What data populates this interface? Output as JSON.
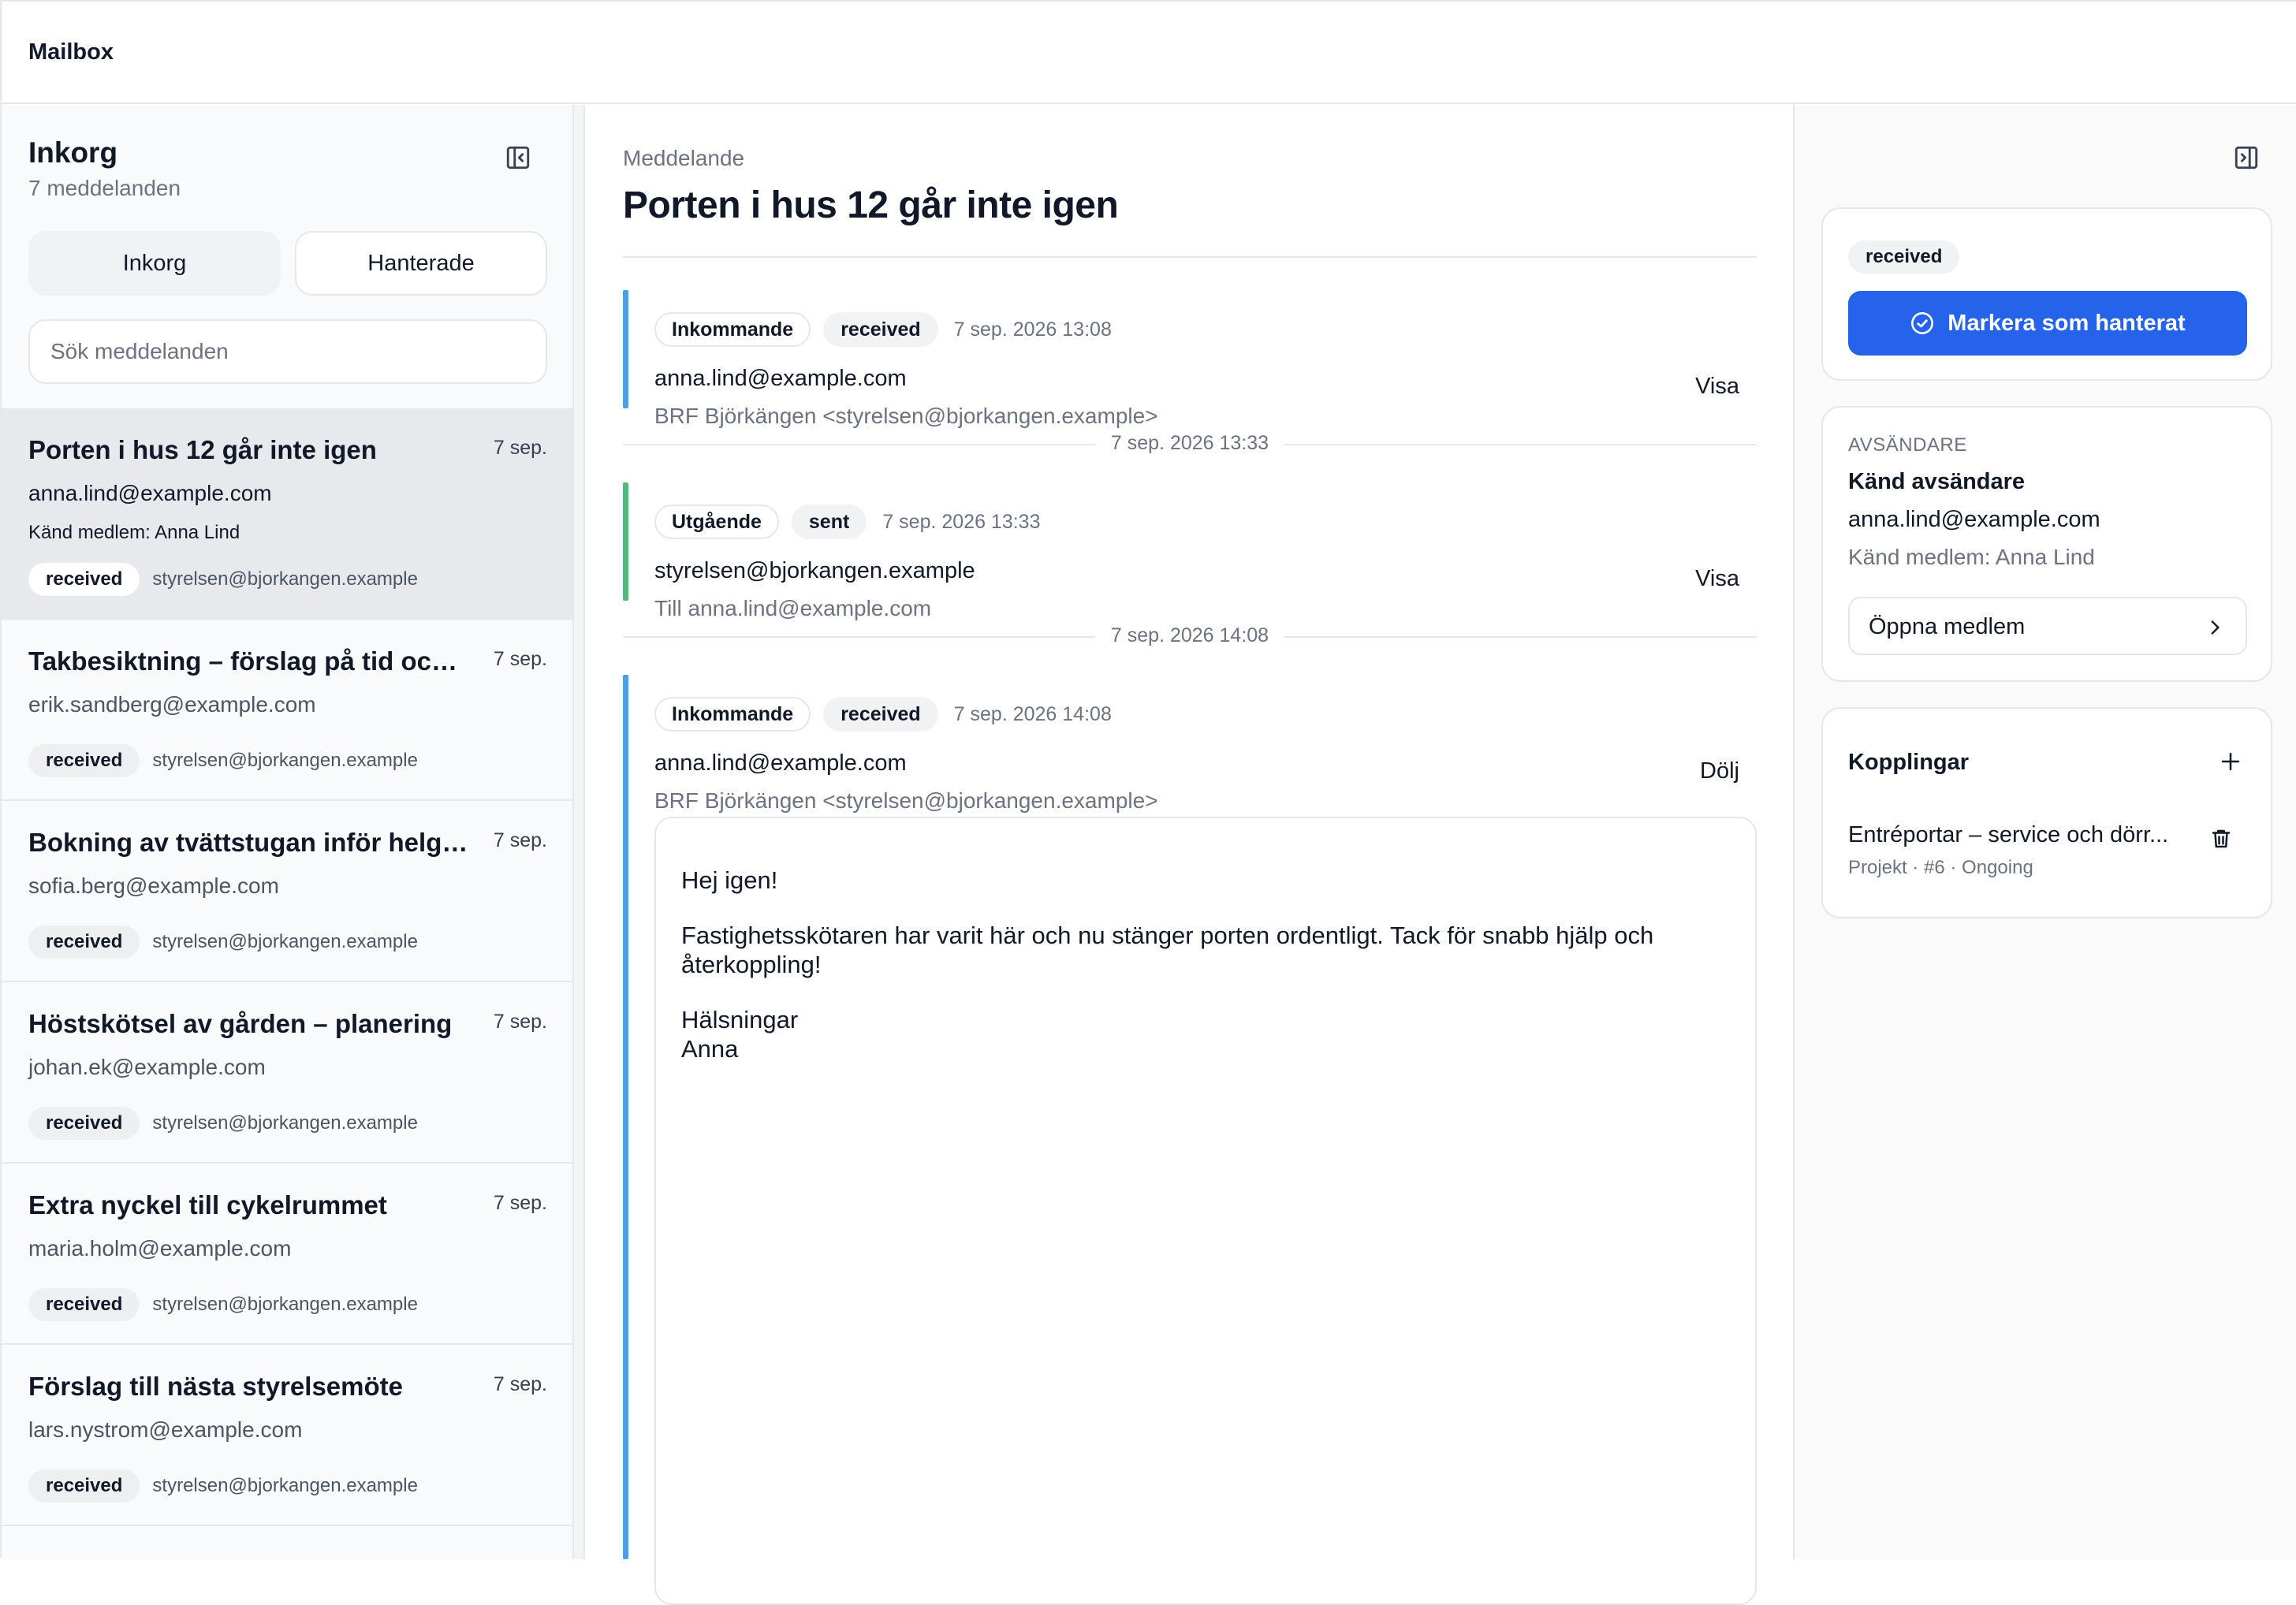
{
  "app": {
    "title": "Mailbox"
  },
  "sidebar": {
    "title": "Inkorg",
    "count": "7 meddelanden",
    "tabs": {
      "inbox": "Inkorg",
      "handled": "Hanterade"
    },
    "search_placeholder": "Sök meddelanden",
    "messages": [
      {
        "subject": "Porten i hus 12 går inte igen",
        "from": "anna.lind@example.com",
        "member": "Känd medlem: Anna Lind",
        "date": "7 sep.",
        "status": "received",
        "to": "styrelsen@bjorkangen.example"
      },
      {
        "subject": "Takbesiktning – förslag på tid och ...",
        "from": "erik.sandberg@example.com",
        "date": "7 sep.",
        "status": "received",
        "to": "styrelsen@bjorkangen.example"
      },
      {
        "subject": "Bokning av tvättstugan inför helgen",
        "from": "sofia.berg@example.com",
        "date": "7 sep.",
        "status": "received",
        "to": "styrelsen@bjorkangen.example"
      },
      {
        "subject": "Höstskötsel av gården – planering",
        "from": "johan.ek@example.com",
        "date": "7 sep.",
        "status": "received",
        "to": "styrelsen@bjorkangen.example"
      },
      {
        "subject": "Extra nyckel till cykelrummet",
        "from": "maria.holm@example.com",
        "date": "7 sep.",
        "status": "received",
        "to": "styrelsen@bjorkangen.example"
      },
      {
        "subject": "Förslag till nästa styrelsemöte",
        "from": "lars.nystrom@example.com",
        "date": "7 sep.",
        "status": "received",
        "to": "styrelsen@bjorkangen.example"
      }
    ]
  },
  "main": {
    "breadcrumb": "Meddelande",
    "title": "Porten i hus 12 går inte igen",
    "thread": [
      {
        "direction": "Inkommande",
        "status": "received",
        "timestamp": "7 sep. 2026 13:08",
        "email": "anna.lind@example.com",
        "sub": "BRF Björkängen <styrelsen@bjorkangen.example>",
        "toggle": "Visa"
      },
      {
        "direction": "Utgående",
        "status": "sent",
        "timestamp": "7 sep. 2026 13:33",
        "email": "styrelsen@bjorkangen.example",
        "sub": "Till anna.lind@example.com",
        "toggle": "Visa"
      },
      {
        "direction": "Inkommande",
        "status": "received",
        "timestamp": "7 sep. 2026 14:08",
        "email": "anna.lind@example.com",
        "sub": "BRF Björkängen <styrelsen@bjorkangen.example>",
        "toggle": "Dölj"
      }
    ],
    "separators": [
      "7 sep. 2026 13:33",
      "7 sep. 2026 14:08"
    ],
    "body": {
      "greeting": "Hej igen!",
      "paragraph": "Fastighetsskötaren har varit här och nu stänger porten ordentligt. Tack för snabb hjälp och återkoppling!",
      "closing": "Hälsningar",
      "signature": "Anna"
    },
    "colors": {
      "incoming": "#4f9fe0",
      "outgoing": "#55b77d"
    }
  },
  "right": {
    "status": "received",
    "mark_handled": "Markera som hanterat",
    "sender": {
      "label": "AVSÄNDARE",
      "known": "Känd avsändare",
      "email": "anna.lind@example.com",
      "member": "Känd medlem: Anna Lind",
      "open_member": "Öppna medlem"
    },
    "links": {
      "title": "Kopplingar",
      "items": [
        {
          "title": "Entréportar – service och dörr...",
          "meta": "Projekt · #6 · Ongoing"
        }
      ]
    },
    "accent": "#2563eb"
  }
}
